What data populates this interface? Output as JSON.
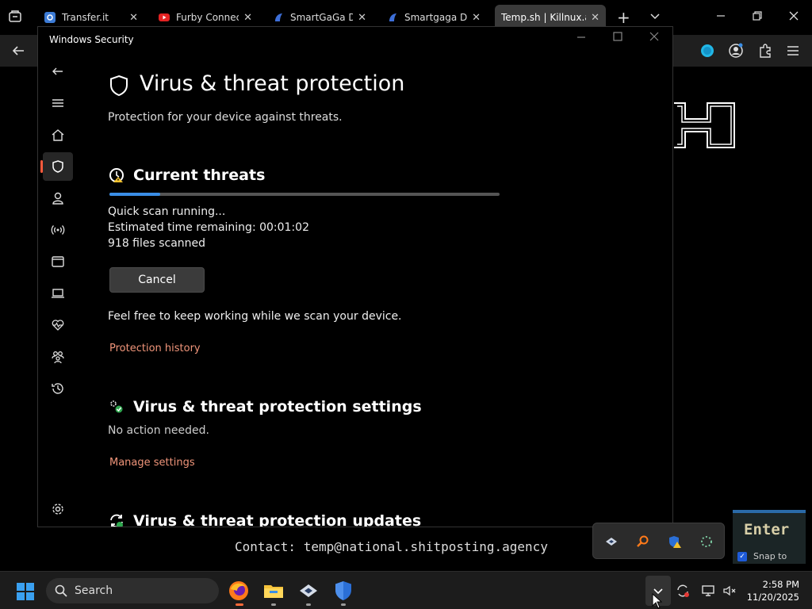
{
  "browser": {
    "tabs": [
      {
        "title": "Transfer.it",
        "icon": "transfer-icon"
      },
      {
        "title": "Furby Connect fi",
        "icon": "youtube-icon"
      },
      {
        "title": "SmartGaGa Dow",
        "icon": "smartgaga-icon"
      },
      {
        "title": "Smartgaga Dow",
        "icon": "smartgaga-icon"
      },
      {
        "title": "Temp.sh | Killnux.apk",
        "icon": "",
        "active": true
      }
    ],
    "new_tab": "+",
    "tab_list": "⌄"
  },
  "page": {
    "contact": "Contact: temp@national.shitposting.agency",
    "enter_label": "Enter",
    "snap_label": "Snap to"
  },
  "window": {
    "title": "Windows Security",
    "nav_items": [
      "back",
      "menu",
      "home",
      "virus-protection",
      "account",
      "firewall",
      "app-browser",
      "device-security",
      "device-health",
      "family",
      "history",
      "settings"
    ],
    "page_title": "Virus & threat protection",
    "page_subtitle": "Protection for your device against threats.",
    "current_threats": {
      "title": "Current threats",
      "progress": 0.13,
      "status": "Quick scan running...",
      "time_remaining": "Estimated time remaining: 00:01:02",
      "files_scanned": "918 files scanned",
      "cancel_label": "Cancel",
      "note": "Feel free to keep working while we scan your device.",
      "history_link": "Protection history"
    },
    "settings_section": {
      "title": "Virus & threat protection settings",
      "status": "No action needed.",
      "link": "Manage settings"
    },
    "updates_section": {
      "title": "Virus & threat protection updates"
    }
  },
  "taskbar": {
    "search_label": "Search",
    "time": "2:58 PM",
    "date": "11/20/2025"
  },
  "colors": {
    "accent": "#3a8ee6",
    "link": "#f0957a",
    "selection": "#ff5a3c"
  }
}
